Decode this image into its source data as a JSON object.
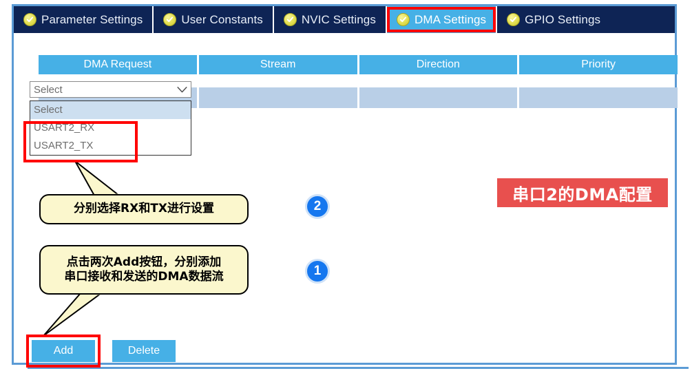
{
  "window": {
    "accent_blue": "#46b0e6",
    "panel_border": "#5b9bd5",
    "tabbar_bg": "#0e2455",
    "highlight_red": "#ff0000",
    "badge_blue": "#1577ef",
    "title_red": "#e8504e",
    "callout_yellow": "#fbf7cd"
  },
  "tabs": [
    {
      "label": "Parameter Settings",
      "icon": "check-circle-icon",
      "active": false,
      "highlighted": false
    },
    {
      "label": "User Constants",
      "icon": "check-circle-icon",
      "active": false,
      "highlighted": false
    },
    {
      "label": "NVIC Settings",
      "icon": "check-circle-icon",
      "active": false,
      "highlighted": false
    },
    {
      "label": "DMA Settings",
      "icon": "check-circle-icon",
      "active": true,
      "highlighted": true
    },
    {
      "label": "GPIO Settings",
      "icon": "check-circle-icon",
      "active": false,
      "highlighted": false
    }
  ],
  "table": {
    "columns": [
      "DMA Request",
      "Stream",
      "Direction",
      "Priority"
    ],
    "rows": [
      {
        "dma_request": "",
        "stream": "",
        "direction": "",
        "priority": ""
      }
    ]
  },
  "dropdown": {
    "value": "Select",
    "caret_icon": "chevron-down-icon",
    "open": true,
    "options": [
      "Select",
      "USART2_RX",
      "USART2_TX"
    ],
    "selected_option": "Select",
    "highlighted_options": [
      "USART2_RX",
      "USART2_TX"
    ]
  },
  "callouts": [
    {
      "id": "callout-step-2",
      "lines": [
        "分别选择RX和TX进行设置"
      ],
      "text": "分别选择RX和TX进行设置",
      "badge": "2"
    },
    {
      "id": "callout-step-1",
      "lines": [
        "点击两次Add按钮，分别添加",
        "串口接收和发送的DMA数据流"
      ],
      "line1": "点击两次Add按钮，分别添加",
      "line2": "串口接收和发送的DMA数据流",
      "badge": "1"
    }
  ],
  "badges": {
    "step2": "2",
    "step1": "1"
  },
  "title_banner": {
    "text": "串口2的DMA配置"
  },
  "buttons": {
    "add": "Add",
    "delete": "Delete"
  }
}
